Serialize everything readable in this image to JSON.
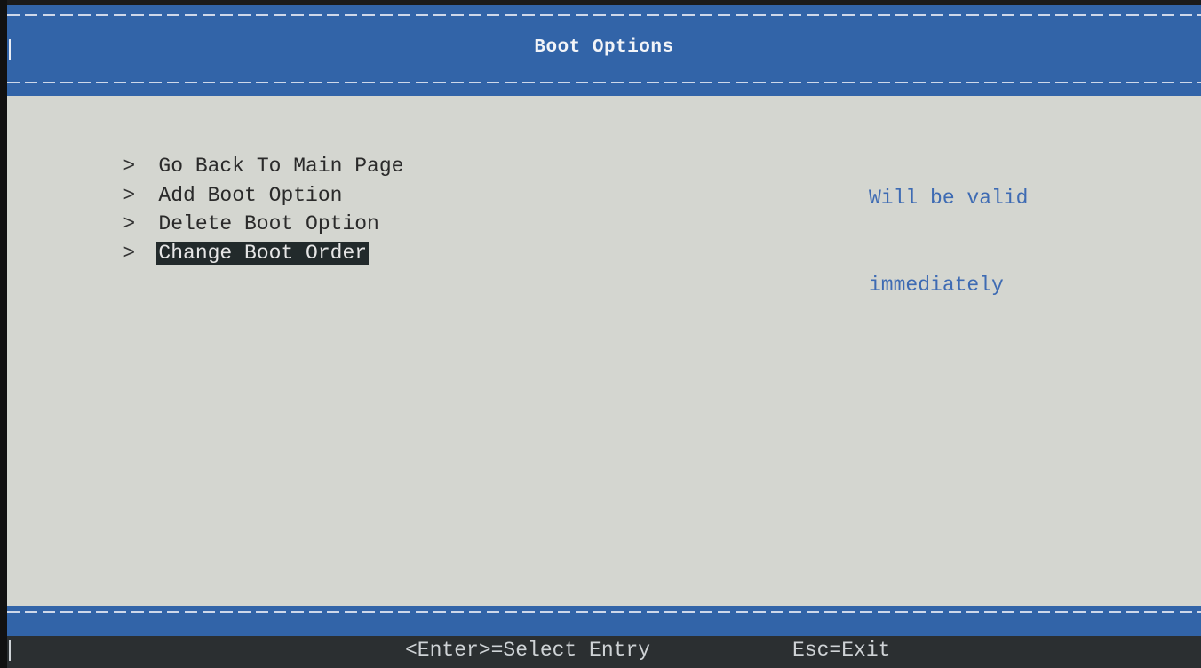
{
  "header": {
    "title": "Boot Options"
  },
  "menu": {
    "items": [
      {
        "arrow": ">",
        "label": "Go Back To Main Page"
      },
      {
        "arrow": ">",
        "label": "Add Boot Option"
      },
      {
        "arrow": ">",
        "label": "Delete Boot Option"
      },
      {
        "arrow": ">",
        "label": "Change Boot Order"
      }
    ],
    "selected_index": 3
  },
  "help": {
    "line1": "Will be valid",
    "line2": "immediately"
  },
  "footer": {
    "enter_hint": "<Enter>=Select Entry",
    "esc_hint": "Esc=Exit"
  },
  "colors": {
    "bar_blue": "#3264a8",
    "body_gray": "#d4d6d0",
    "help_blue": "#3e6bb3",
    "selection_bg": "#222a2b"
  }
}
